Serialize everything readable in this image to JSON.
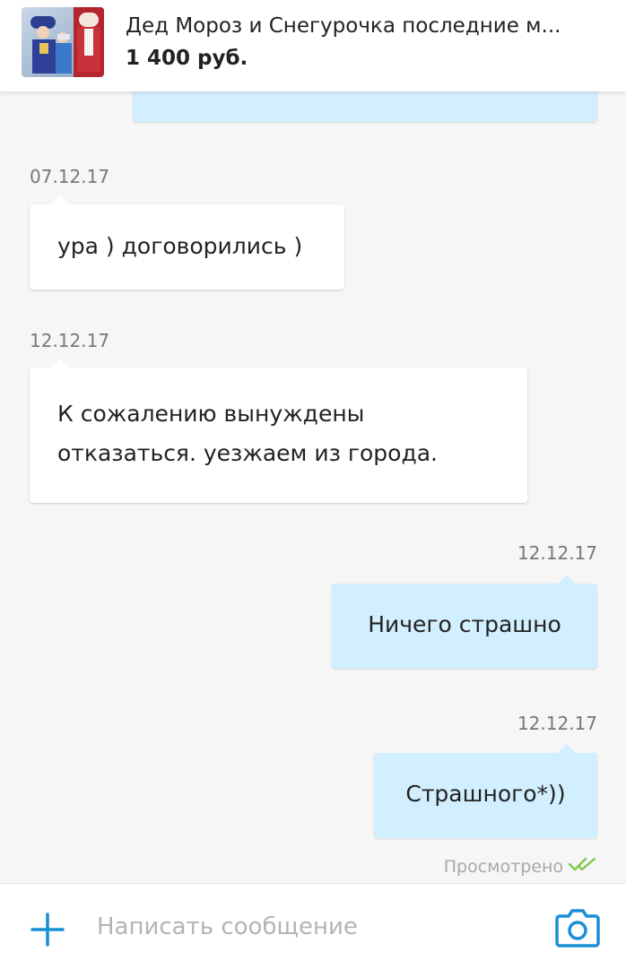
{
  "listing": {
    "title": "Дед Мороз и Снегурочка последние м...",
    "price": "1 400 руб.",
    "thumbnail_icon": "listing-photo"
  },
  "messages": [
    {
      "direction": "outgoing",
      "date": "",
      "text": ""
    },
    {
      "direction": "incoming",
      "date": "07.12.17",
      "text": "ура ) договорились )"
    },
    {
      "direction": "incoming",
      "date": "12.12.17",
      "text": "К сожалению вынуждены отказаться. уезжаем из города."
    },
    {
      "direction": "outgoing",
      "date": "12.12.17",
      "text": "Ничего страшно"
    },
    {
      "direction": "outgoing",
      "date": "12.12.17",
      "text": "Страшного*))"
    }
  ],
  "read_status": {
    "label": "Просмотрено",
    "icon": "double-check-icon"
  },
  "composer": {
    "placeholder": "Написать сообщение",
    "value": "",
    "attach_icon": "plus-icon",
    "camera_icon": "camera-icon"
  },
  "colors": {
    "accent": "#1a8fd6",
    "outgoing_bubble": "#d2efff",
    "incoming_bubble": "#ffffff",
    "read_check": "#7ec84a",
    "background": "#f6f6f6"
  }
}
